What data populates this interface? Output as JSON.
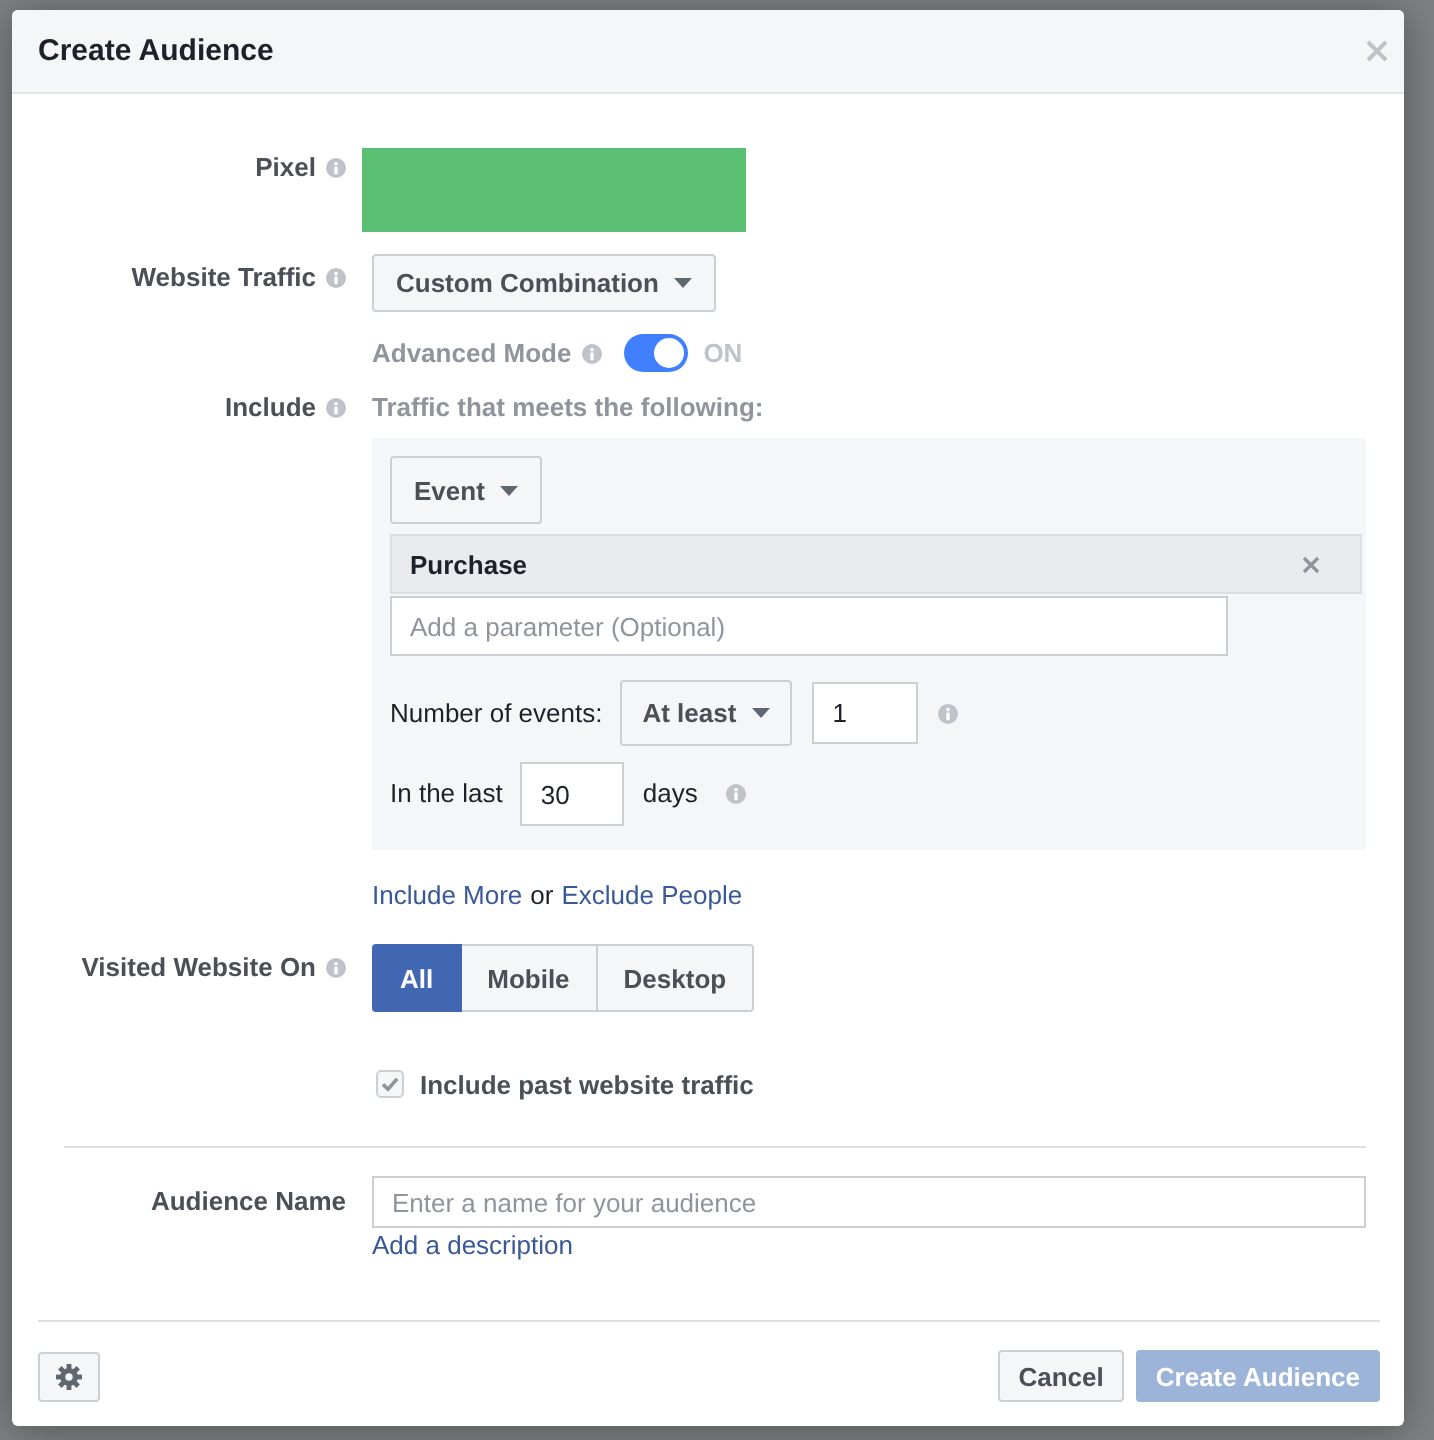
{
  "window": {
    "title": "Create Audience"
  },
  "pixel": {
    "label": "Pixel"
  },
  "website_traffic": {
    "label": "Website Traffic",
    "value": "Custom Combination"
  },
  "advanced_mode": {
    "label": "Advanced Mode",
    "on": true,
    "state_text": "ON"
  },
  "include": {
    "label": "Include",
    "hint": "Traffic that meets the following:",
    "source": "Event",
    "event": "Purchase",
    "parameter_placeholder": "Add a parameter (Optional)",
    "count_label": "Number of events:",
    "count_operator": "At least",
    "count_value": "1",
    "period_label": "In the last",
    "period_value": "30",
    "period_unit": "days"
  },
  "include_links": [
    {
      "kind": "link",
      "text": "Include More"
    },
    {
      "kind": "text",
      "text": "or"
    },
    {
      "kind": "link",
      "text": "Exclude People"
    }
  ],
  "visited_website_on": {
    "label": "Visited Website On",
    "options": [
      {
        "label": "All",
        "selected": true
      },
      {
        "label": "Mobile",
        "selected": false
      },
      {
        "label": "Desktop",
        "selected": false
      }
    ]
  },
  "past_traffic": {
    "label": "Include past website traffic",
    "checked": true
  },
  "audience_name": {
    "label": "Audience Name",
    "placeholder": "Enter a name for your audience",
    "description_link": "Add a description"
  },
  "footer": {
    "buttons": [
      {
        "label": "Cancel",
        "kind": "secondary",
        "disabled": false
      },
      {
        "label": "Create Audience",
        "kind": "primary",
        "disabled": true
      }
    ]
  }
}
